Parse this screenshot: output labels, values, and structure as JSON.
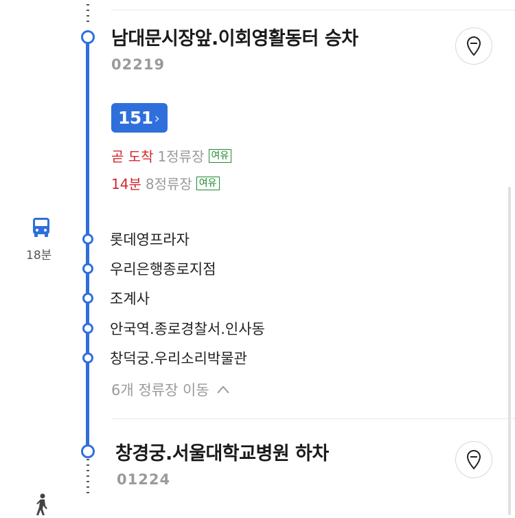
{
  "boarding": {
    "title": "남대문시장앞.이회영활동터 승차",
    "id": "02219"
  },
  "bus": {
    "number": "151"
  },
  "arrivals": [
    {
      "time": "곧 도착",
      "stops": "1정류장",
      "status": "여유"
    },
    {
      "time": "14분",
      "stops": "8정류장",
      "status": "여유"
    }
  ],
  "ride": {
    "duration": "18분"
  },
  "stops": [
    "롯데영프라자",
    "우리은행종로지점",
    "조계사",
    "안국역.종로경찰서.인사동",
    "창덕궁.우리소리박물관"
  ],
  "moves_label": "6개 정류장 이동",
  "alighting": {
    "title": "창경궁.서울대학교병원 하차",
    "id": "01224"
  },
  "colors": {
    "accent": "#2f6fdc",
    "arrival_red": "#d4262b",
    "status_green": "#1d8a2e"
  }
}
